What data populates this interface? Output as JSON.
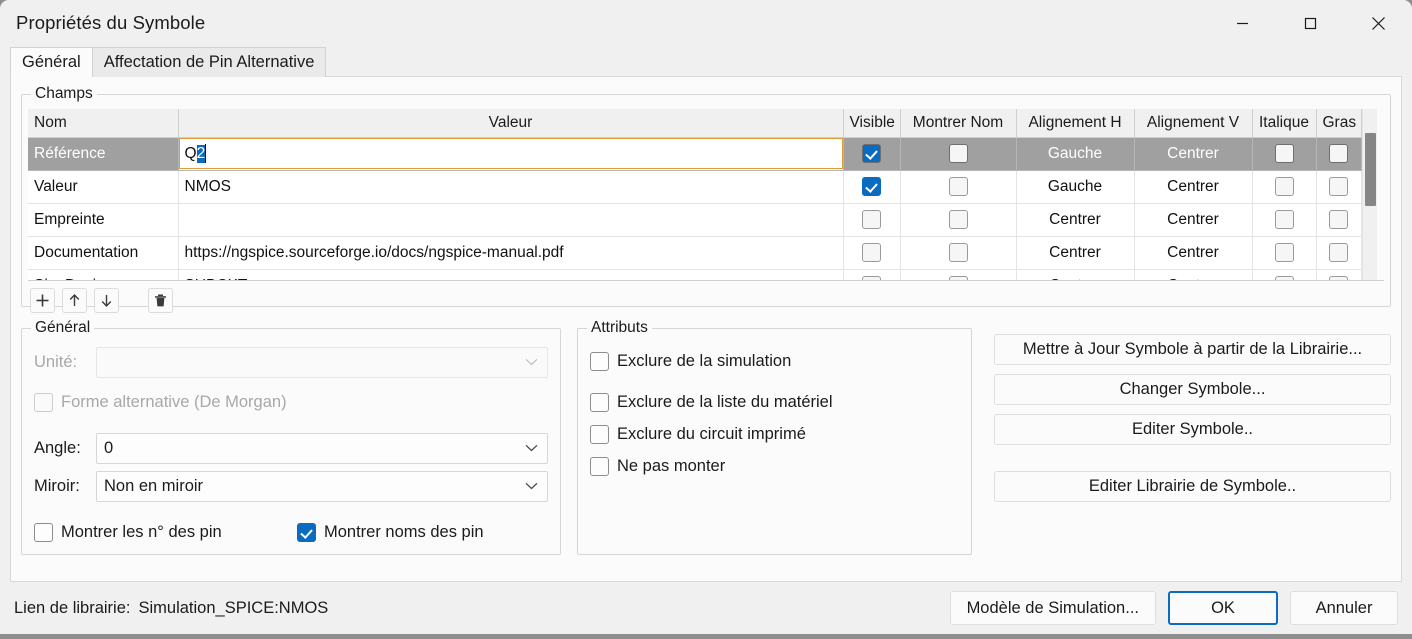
{
  "window": {
    "title": "Propriétés du Symbole",
    "controls": [
      {
        "name": "minimize",
        "glyph": "minimize-icon"
      },
      {
        "name": "maximize",
        "glyph": "maximize-icon"
      },
      {
        "name": "close",
        "glyph": "close-icon"
      }
    ]
  },
  "tabs": [
    {
      "label": "Général",
      "active": true
    },
    {
      "label": "Affectation de Pin Alternative",
      "active": false
    }
  ],
  "fields_group": {
    "label": "Champs",
    "columns": [
      "Nom",
      "Valeur",
      "Visible",
      "Montrer Nom",
      "Alignement H",
      "Alignement V",
      "Italique",
      "Gras"
    ],
    "rows": [
      {
        "name": "Référence",
        "value": "Q2",
        "value_prefix": "Q",
        "value_selected": "2",
        "visible": true,
        "show_name": false,
        "align_h": "Gauche",
        "align_v": "Centrer",
        "italic": false,
        "bold": false,
        "selected": true,
        "editing": true
      },
      {
        "name": "Valeur",
        "value": "NMOS",
        "visible": true,
        "show_name": false,
        "align_h": "Gauche",
        "align_v": "Centrer",
        "italic": false,
        "bold": false,
        "selected": false,
        "editing": false
      },
      {
        "name": "Empreinte",
        "value": "",
        "visible": false,
        "show_name": false,
        "align_h": "Centrer",
        "align_v": "Centrer",
        "italic": false,
        "bold": false,
        "selected": false,
        "editing": false
      },
      {
        "name": "Documentation",
        "value": "https://ngspice.sourceforge.io/docs/ngspice-manual.pdf",
        "visible": false,
        "show_name": false,
        "align_h": "Centrer",
        "align_v": "Centrer",
        "italic": false,
        "bold": false,
        "selected": false,
        "editing": false
      },
      {
        "name": "Sim.Device",
        "value": "SUBCKT",
        "visible": false,
        "show_name": false,
        "align_h": "Centrer",
        "align_v": "Centrer",
        "italic": false,
        "bold": false,
        "selected": false,
        "editing": false
      }
    ],
    "toolbar": [
      {
        "name": "add-field-button",
        "icon": "plus-icon"
      },
      {
        "name": "move-field-up-button",
        "icon": "arrow-up-icon"
      },
      {
        "name": "move-field-down-button",
        "icon": "arrow-down-icon"
      },
      {
        "name": "delete-field-button",
        "icon": "trash-icon"
      }
    ]
  },
  "general_group": {
    "label": "Général",
    "unit_label": "Unité:",
    "unit_value": "",
    "unit_disabled": true,
    "demorgan_label": "Forme alternative (De Morgan)",
    "demorgan_checked": false,
    "demorgan_disabled": true,
    "angle_label": "Angle:",
    "angle_value": "0",
    "mirror_label": "Miroir:",
    "mirror_value": "Non en miroir",
    "show_pin_numbers_label": "Montrer les n° des pin",
    "show_pin_numbers_checked": false,
    "show_pin_names_label": "Montrer noms des pin",
    "show_pin_names_checked": true
  },
  "attributes_group": {
    "label": "Attributs",
    "items": [
      {
        "label": "Exclure de la simulation",
        "checked": false
      },
      {
        "label": "Exclure de la liste du matériel",
        "checked": false
      },
      {
        "label": "Exclure du circuit imprimé",
        "checked": false
      },
      {
        "label": "Ne pas monter",
        "checked": false
      }
    ]
  },
  "side_buttons": [
    {
      "label": "Mettre à Jour Symbole à partir de la Librairie..."
    },
    {
      "label": "Changer Symbole..."
    },
    {
      "label": "Editer Symbole.."
    },
    {
      "label": "Editer Librairie de Symbole.."
    }
  ],
  "footer": {
    "library_link_label": "Lien de librairie:",
    "library_link_value": "Simulation_SPICE:NMOS",
    "simulation_model_button": "Modèle de Simulation...",
    "ok_button": "OK",
    "cancel_button": "Annuler"
  },
  "colors": {
    "accent": "#0b6bc0",
    "selection_row": "#a0a0a0",
    "editor_border": "#e09b3a",
    "dialog_bg": "#f0f0f0",
    "panel_bg": "#fbfbfb"
  }
}
